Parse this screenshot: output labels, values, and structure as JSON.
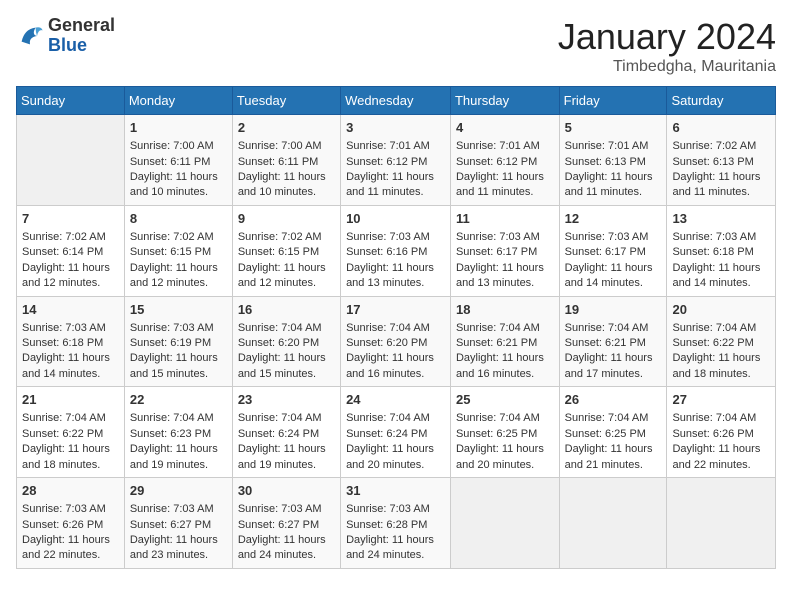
{
  "header": {
    "logo_general": "General",
    "logo_blue": "Blue",
    "month": "January 2024",
    "location": "Timbedgha, Mauritania"
  },
  "weekdays": [
    "Sunday",
    "Monday",
    "Tuesday",
    "Wednesday",
    "Thursday",
    "Friday",
    "Saturday"
  ],
  "weeks": [
    [
      {
        "day": "",
        "text": ""
      },
      {
        "day": "1",
        "text": "Sunrise: 7:00 AM\nSunset: 6:11 PM\nDaylight: 11 hours\nand 10 minutes."
      },
      {
        "day": "2",
        "text": "Sunrise: 7:00 AM\nSunset: 6:11 PM\nDaylight: 11 hours\nand 10 minutes."
      },
      {
        "day": "3",
        "text": "Sunrise: 7:01 AM\nSunset: 6:12 PM\nDaylight: 11 hours\nand 11 minutes."
      },
      {
        "day": "4",
        "text": "Sunrise: 7:01 AM\nSunset: 6:12 PM\nDaylight: 11 hours\nand 11 minutes."
      },
      {
        "day": "5",
        "text": "Sunrise: 7:01 AM\nSunset: 6:13 PM\nDaylight: 11 hours\nand 11 minutes."
      },
      {
        "day": "6",
        "text": "Sunrise: 7:02 AM\nSunset: 6:13 PM\nDaylight: 11 hours\nand 11 minutes."
      }
    ],
    [
      {
        "day": "7",
        "text": "Sunrise: 7:02 AM\nSunset: 6:14 PM\nDaylight: 11 hours\nand 12 minutes."
      },
      {
        "day": "8",
        "text": "Sunrise: 7:02 AM\nSunset: 6:15 PM\nDaylight: 11 hours\nand 12 minutes."
      },
      {
        "day": "9",
        "text": "Sunrise: 7:02 AM\nSunset: 6:15 PM\nDaylight: 11 hours\nand 12 minutes."
      },
      {
        "day": "10",
        "text": "Sunrise: 7:03 AM\nSunset: 6:16 PM\nDaylight: 11 hours\nand 13 minutes."
      },
      {
        "day": "11",
        "text": "Sunrise: 7:03 AM\nSunset: 6:17 PM\nDaylight: 11 hours\nand 13 minutes."
      },
      {
        "day": "12",
        "text": "Sunrise: 7:03 AM\nSunset: 6:17 PM\nDaylight: 11 hours\nand 14 minutes."
      },
      {
        "day": "13",
        "text": "Sunrise: 7:03 AM\nSunset: 6:18 PM\nDaylight: 11 hours\nand 14 minutes."
      }
    ],
    [
      {
        "day": "14",
        "text": "Sunrise: 7:03 AM\nSunset: 6:18 PM\nDaylight: 11 hours\nand 14 minutes."
      },
      {
        "day": "15",
        "text": "Sunrise: 7:03 AM\nSunset: 6:19 PM\nDaylight: 11 hours\nand 15 minutes."
      },
      {
        "day": "16",
        "text": "Sunrise: 7:04 AM\nSunset: 6:20 PM\nDaylight: 11 hours\nand 15 minutes."
      },
      {
        "day": "17",
        "text": "Sunrise: 7:04 AM\nSunset: 6:20 PM\nDaylight: 11 hours\nand 16 minutes."
      },
      {
        "day": "18",
        "text": "Sunrise: 7:04 AM\nSunset: 6:21 PM\nDaylight: 11 hours\nand 16 minutes."
      },
      {
        "day": "19",
        "text": "Sunrise: 7:04 AM\nSunset: 6:21 PM\nDaylight: 11 hours\nand 17 minutes."
      },
      {
        "day": "20",
        "text": "Sunrise: 7:04 AM\nSunset: 6:22 PM\nDaylight: 11 hours\nand 18 minutes."
      }
    ],
    [
      {
        "day": "21",
        "text": "Sunrise: 7:04 AM\nSunset: 6:22 PM\nDaylight: 11 hours\nand 18 minutes."
      },
      {
        "day": "22",
        "text": "Sunrise: 7:04 AM\nSunset: 6:23 PM\nDaylight: 11 hours\nand 19 minutes."
      },
      {
        "day": "23",
        "text": "Sunrise: 7:04 AM\nSunset: 6:24 PM\nDaylight: 11 hours\nand 19 minutes."
      },
      {
        "day": "24",
        "text": "Sunrise: 7:04 AM\nSunset: 6:24 PM\nDaylight: 11 hours\nand 20 minutes."
      },
      {
        "day": "25",
        "text": "Sunrise: 7:04 AM\nSunset: 6:25 PM\nDaylight: 11 hours\nand 20 minutes."
      },
      {
        "day": "26",
        "text": "Sunrise: 7:04 AM\nSunset: 6:25 PM\nDaylight: 11 hours\nand 21 minutes."
      },
      {
        "day": "27",
        "text": "Sunrise: 7:04 AM\nSunset: 6:26 PM\nDaylight: 11 hours\nand 22 minutes."
      }
    ],
    [
      {
        "day": "28",
        "text": "Sunrise: 7:03 AM\nSunset: 6:26 PM\nDaylight: 11 hours\nand 22 minutes."
      },
      {
        "day": "29",
        "text": "Sunrise: 7:03 AM\nSunset: 6:27 PM\nDaylight: 11 hours\nand 23 minutes."
      },
      {
        "day": "30",
        "text": "Sunrise: 7:03 AM\nSunset: 6:27 PM\nDaylight: 11 hours\nand 24 minutes."
      },
      {
        "day": "31",
        "text": "Sunrise: 7:03 AM\nSunset: 6:28 PM\nDaylight: 11 hours\nand 24 minutes."
      },
      {
        "day": "",
        "text": ""
      },
      {
        "day": "",
        "text": ""
      },
      {
        "day": "",
        "text": ""
      }
    ]
  ]
}
